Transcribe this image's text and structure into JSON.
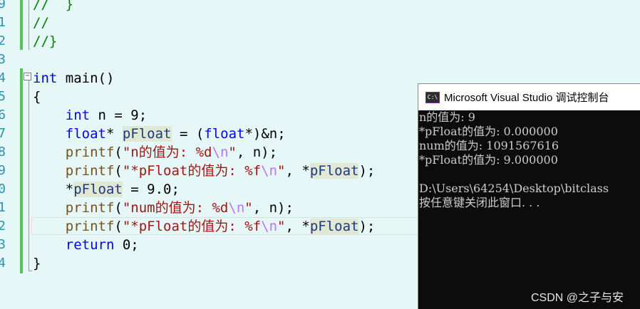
{
  "editor": {
    "line_numbers": [
      "9",
      "1",
      "2",
      "3",
      "4",
      "5",
      "6",
      "7",
      "8",
      "9",
      "0",
      "1",
      "2",
      "3",
      "4"
    ],
    "lines": {
      "l0": {
        "indent": "",
        "comment": "//  }"
      },
      "l1": {
        "indent": "",
        "comment": "//"
      },
      "l2": {
        "indent": "",
        "comment": "//}"
      },
      "l4": {
        "kw_int": "int",
        "main": " main()"
      },
      "l5": {
        "brace": "{"
      },
      "l6": {
        "indent": "    ",
        "kw": "int",
        "rest": " n = 9;"
      },
      "l7": {
        "indent": "    ",
        "kw1": "float",
        "star": "* ",
        "var": "pFloat",
        "mid": " = (",
        "kw2": "float",
        "tail": "*)&n;"
      },
      "l8": {
        "indent": "    ",
        "fn": "printf",
        "open": "(",
        "str1": "\"n的值为: %d",
        "esc": "\\n",
        "str2": "\"",
        "tail": ", n);"
      },
      "l9": {
        "indent": "    ",
        "fn": "printf",
        "open": "(",
        "str1": "\"*pFloat的值为: %f",
        "esc": "\\n",
        "str2": "\"",
        "mid": ", *",
        "var": "pFloat",
        "tail": ");"
      },
      "l10": {
        "indent": "    ",
        "star": "*",
        "var": "pFloat",
        "tail": " = 9.0;"
      },
      "l11": {
        "indent": "    ",
        "fn": "printf",
        "open": "(",
        "str1": "\"num的值为: %d",
        "esc": "\\n",
        "str2": "\"",
        "tail": ", n);"
      },
      "l12": {
        "indent": "    ",
        "fn": "printf",
        "open": "(",
        "str1": "\"*pFloat的值为: %f",
        "esc": "\\n",
        "str2": "\"",
        "mid": ", *",
        "var": "pFloat",
        "tail": ");"
      },
      "l13": {
        "indent": "    ",
        "kw": "return",
        "tail": " 0;"
      },
      "l14": {
        "brace": "}"
      }
    }
  },
  "console": {
    "title": "Microsoft Visual Studio 调试控制台",
    "icon_text": "C:\\",
    "output": [
      "n的值为: 9",
      "*pFloat的值为: 0.000000",
      "num的值为: 1091567616",
      "*pFloat的值为: 9.000000",
      "",
      "D:\\Users\\64254\\Desktop\\bitclass",
      "按任意键关闭此窗口. . ."
    ]
  },
  "watermark": "CSDN @之子与安",
  "colors": {
    "editor_bg": "#e6f7f7",
    "keyword": "#0000ff",
    "comment": "#008000",
    "string": "#a31515",
    "console_bg": "#0c0c0c",
    "console_text": "#cccccc"
  }
}
